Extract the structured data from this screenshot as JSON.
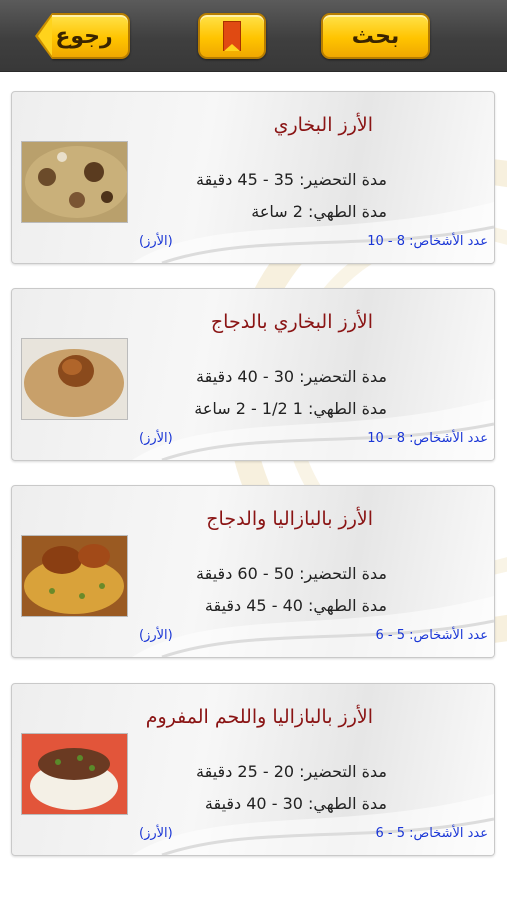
{
  "header": {
    "back_label": "رجوع",
    "search_label": "بحث",
    "bookmark_icon": "bookmark-icon"
  },
  "colors": {
    "title": "#8a1414",
    "link": "#1a36d6",
    "button": "#ffc400",
    "topbar": "#454545"
  },
  "recipes": [
    {
      "title": "الأرز البخاري",
      "prep": "مدة التحضير: 35 - 45 دقيقة",
      "cook": "مدة الطهي: 2 ساعة",
      "persons": "عدد الأشخاص: 8 - 10",
      "category": "(الأرز)",
      "image": "rice-bukhari-photo"
    },
    {
      "title": "الأرز البخاري بالدجاج",
      "prep": "مدة التحضير: 30 - 40 دقيقة",
      "cook": "مدة الطهي: 1 1/2 - 2 ساعة",
      "persons": "عدد الأشخاص: 8 - 10",
      "category": "(الأرز)",
      "image": "rice-chicken-photo"
    },
    {
      "title": "الأرز بالبازاليا والدجاج",
      "prep": "مدة التحضير: 50 - 60 دقيقة",
      "cook": "مدة الطهي: 40 - 45 دقيقة",
      "persons": "عدد الأشخاص: 5 - 6",
      "category": "(الأرز)",
      "image": "rice-peas-chicken-photo"
    },
    {
      "title": "الأرز بالبازاليا واللحم المفروم",
      "prep": "مدة التحضير: 20 - 25 دقيقة",
      "cook": "مدة الطهي: 30 - 40 دقيقة",
      "persons": "عدد الأشخاص: 5 - 6",
      "category": "(الأرز)",
      "image": "rice-peas-mince-photo"
    }
  ]
}
